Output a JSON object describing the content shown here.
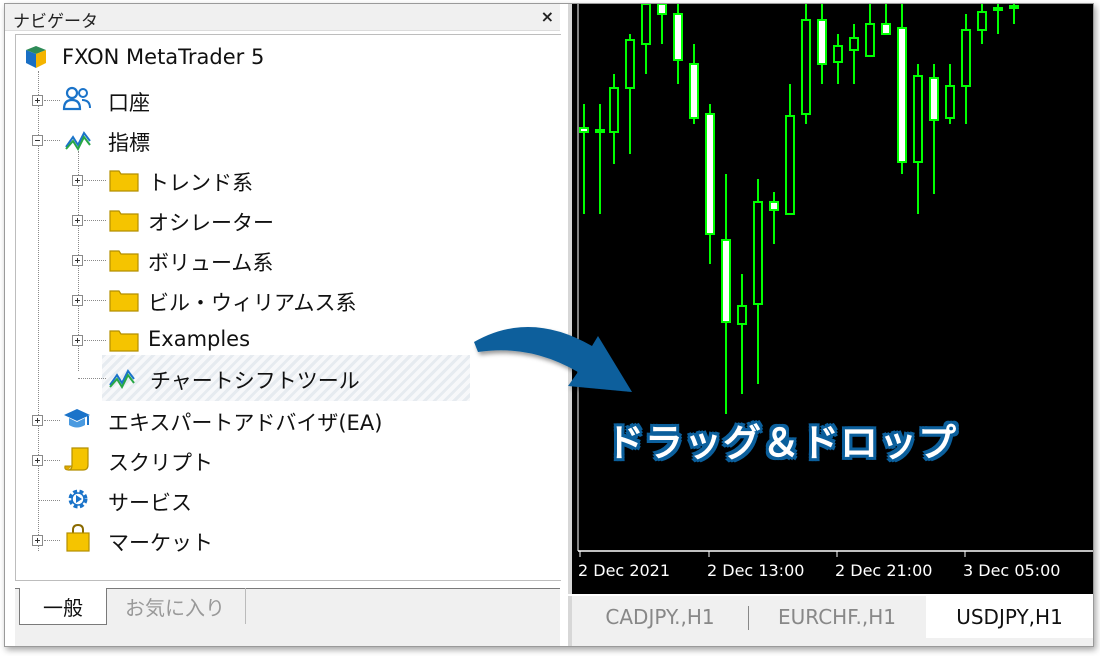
{
  "navigator": {
    "title": "ナビゲータ",
    "close": "×",
    "root": "FXON MetaTrader 5",
    "items": {
      "accounts": "口座",
      "indicators": "指標",
      "trend": "トレンド系",
      "oscillators": "オシレーター",
      "volumes": "ボリューム系",
      "bill_williams": "ビル・ウィリアムス系",
      "examples": "Examples",
      "chart_shift": "チャートシフトツール",
      "experts": "エキスパートアドバイザ(EA)",
      "scripts": "スクリプト",
      "services": "サービス",
      "market": "マーケット"
    },
    "tabs": {
      "general": "一般",
      "favorites": "お気に入り"
    }
  },
  "chart": {
    "time_labels": [
      "2 Dec 2021",
      "2 Dec 13:00",
      "2 Dec 21:00",
      "3 Dec 05:00"
    ],
    "symbol_tabs": [
      "CADJPY.,H1",
      "EURCHF.,H1",
      "USDJPY,H1"
    ],
    "active_tab": "USDJPY,H1"
  },
  "annotation": {
    "text": "ドラッグ＆ドロップ"
  },
  "colors": {
    "candle": "#00ff00",
    "chart_bg": "#000000",
    "arrow": "#0b5f9c",
    "folder": "#f5c400"
  }
}
